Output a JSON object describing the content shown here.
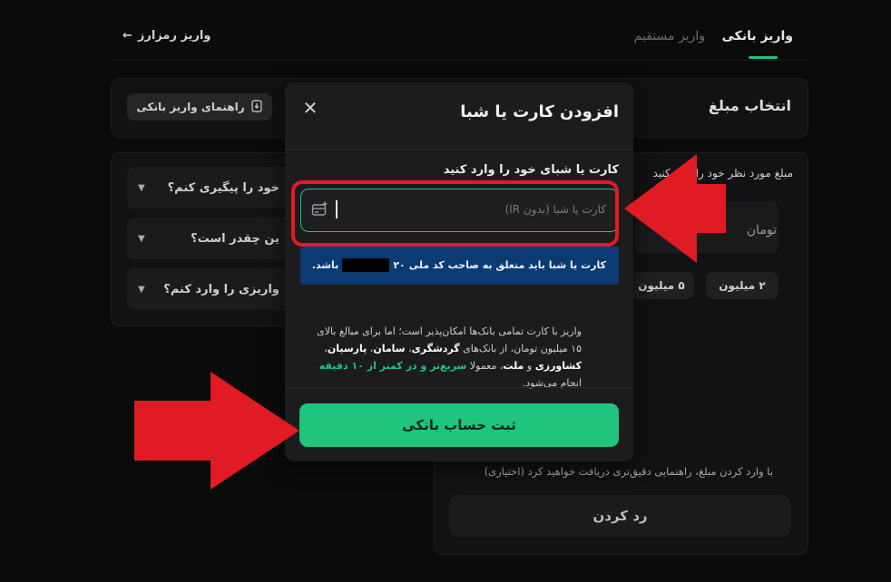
{
  "tabs": {
    "bank_deposit": "واریز بانکی",
    "direct_deposit": "واریز مستقیم",
    "crypto_deposit": "واریز رمزارز"
  },
  "amount_section": {
    "title": "انتخاب مبلغ",
    "guide_button": "راهنمای واریز بانکی",
    "hint": "مبلغ مورد نظر خود را وارد کنید",
    "unit": "تومان",
    "chips": [
      "۲ میلیون",
      "۵ میلیون"
    ],
    "optional_text": "با وارد کردن مبلغ، راهنمایی دقیق‌تری دریافت خواهید کرد (اختیاری)",
    "cancel_button": "رد کردن"
  },
  "faq": [
    "خود را پیگیری کنم؟",
    "ین چقدر است؟",
    "واریزی را وارد کنم؟"
  ],
  "modal": {
    "title": "افزودن کارت یا شبا",
    "field_label": "کارت یا شبای خود را وارد کنید",
    "input_placeholder": "کارت یا شبا (بدون IR)",
    "info_prefix": "کارت یا شبا باید متعلق به صاحب کد ملی",
    "info_code_prefix": "۲۰",
    "info_suffix": "باشد.",
    "desc_1": "واریز با کارت تمامی بانک‌ها امکان‌پذیر است؛ اما برای مبالغ بالای ۱۵ میلیون تومان، از بانک‌های",
    "bank_1": "گردشگری",
    "bank_2": "سامان",
    "bank_3": "پارسیان",
    "bank_4": "کشاورزی",
    "and_word": "و",
    "bank_5": "ملت",
    "desc_2": "، معمولا",
    "desc_green": "سریع‌تر و در کمتر از ۱۰ دقیقه",
    "desc_3": "انجام می‌شود.",
    "submit_button": "ثبت حساب بانکی"
  },
  "colors": {
    "accent": "#1fc47d",
    "info_bg": "#0c3a73",
    "highlight": "#e01b24"
  }
}
